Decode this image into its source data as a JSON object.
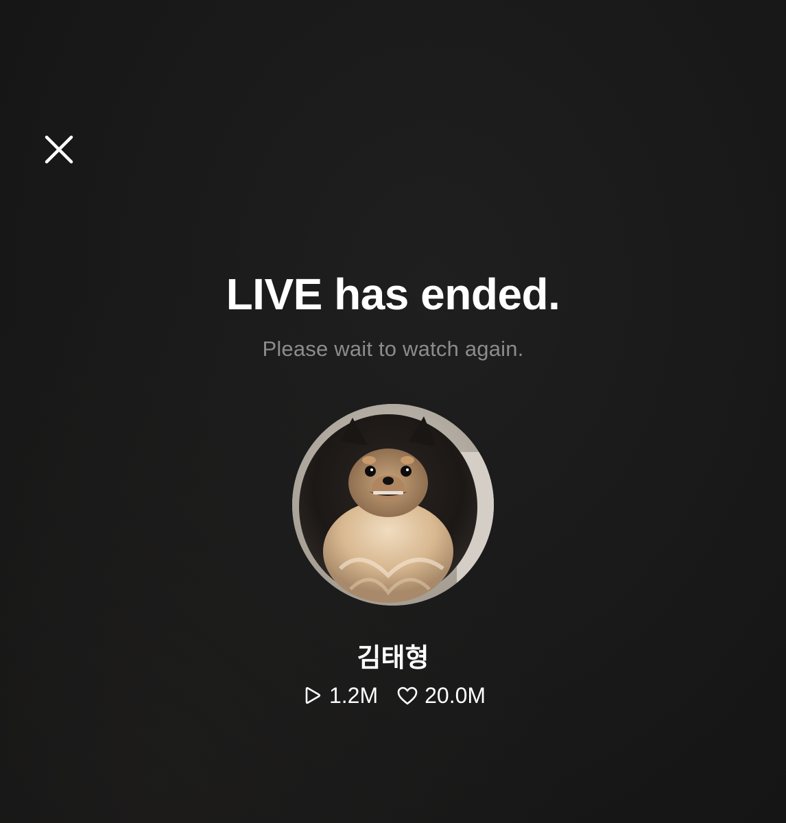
{
  "header": {
    "close_icon": "close-icon"
  },
  "message": {
    "title": "LIVE has ended.",
    "subtitle": "Please wait to watch again."
  },
  "profile": {
    "avatar": "pomeranian-dog-avatar",
    "name": "김태형"
  },
  "stats": {
    "views_icon": "play-icon",
    "views": "1.2M",
    "likes_icon": "heart-icon",
    "likes": "20.0M"
  },
  "colors": {
    "background": "#1a1a1a",
    "text_primary": "#ffffff",
    "text_secondary": "#8c8c8c"
  }
}
